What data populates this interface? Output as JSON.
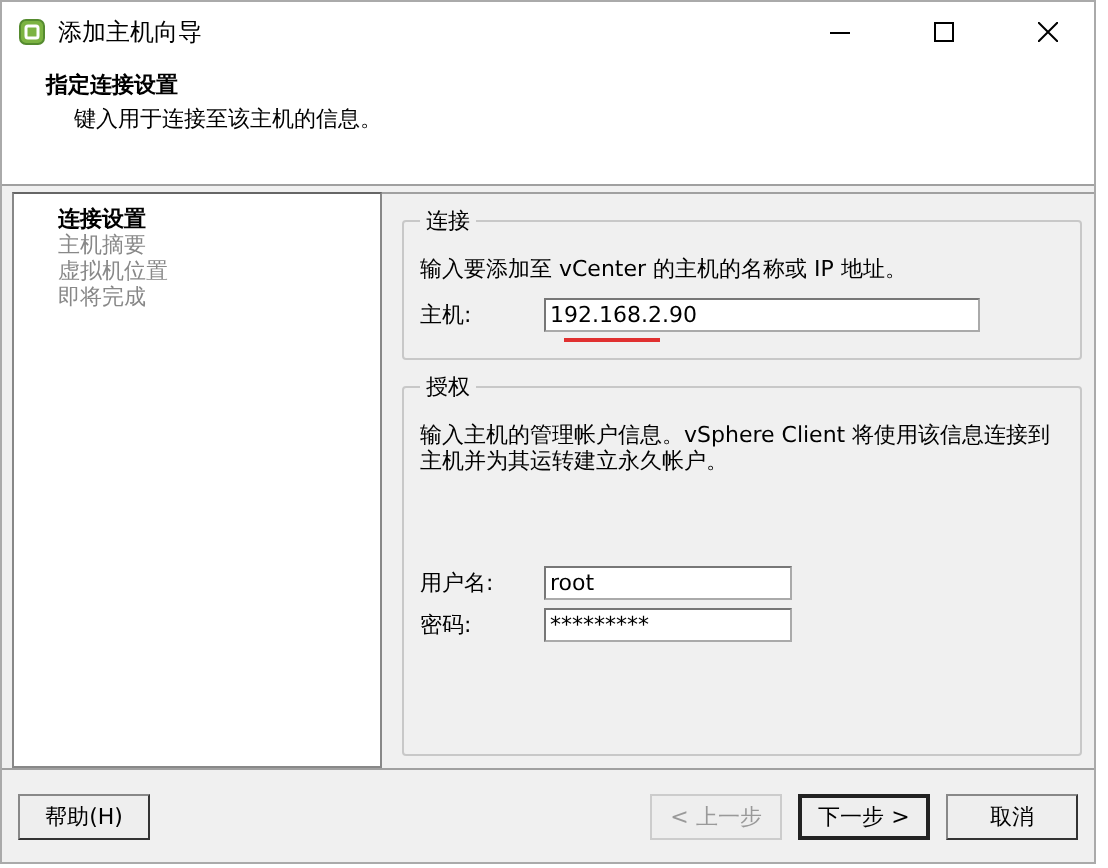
{
  "window": {
    "title": "添加主机向导"
  },
  "header": {
    "title": "指定连接设置",
    "subtitle": "键入用于连接至该主机的信息。"
  },
  "steps": [
    {
      "label": "连接设置",
      "selected": true
    },
    {
      "label": "主机摘要",
      "selected": false
    },
    {
      "label": "虚拟机位置",
      "selected": false
    },
    {
      "label": "即将完成",
      "selected": false
    }
  ],
  "connection": {
    "legend": "连接",
    "description": "输入要添加至 vCenter 的主机的名称或 IP 地址。",
    "host_label": "主机:",
    "host_value": "192.168.2.90"
  },
  "authorization": {
    "legend": "授权",
    "description": "输入主机的管理帐户信息。vSphere Client 将使用该信息连接到主机并为其运转建立永久帐户。",
    "username_label": "用户名:",
    "username_value": "root",
    "password_label": "密码:",
    "password_value": "*********"
  },
  "buttons": [
    {
      "label": "帮助(H)",
      "disabled": false,
      "default": false
    },
    {
      "label": "< 上一步",
      "disabled": true,
      "default": false
    },
    {
      "label": "下一步 >",
      "disabled": false,
      "default": true
    },
    {
      "label": "取消",
      "disabled": false,
      "default": false
    }
  ]
}
